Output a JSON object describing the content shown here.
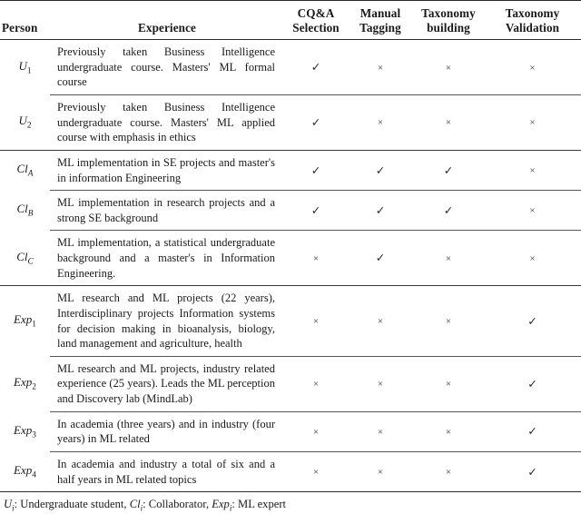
{
  "table": {
    "headers": {
      "person": "Person",
      "experience": "Experience",
      "cqa_selection": [
        "CQ&A",
        "Selection"
      ],
      "manual_tagging": [
        "Manual",
        "Tagging"
      ],
      "taxonomy_building": [
        "Taxonomy",
        "building"
      ],
      "taxonomy_validation": [
        "Taxonomy",
        "Validation"
      ]
    },
    "marks": {
      "check": "✓",
      "cross": "×"
    },
    "groups": [
      {
        "name": "undergraduate-students",
        "rows": [
          {
            "person_base": "U",
            "person_sub": "1",
            "experience": "Previously taken Business Intelligence undergraduate course. Masters' ML formal course",
            "cqa_selection": "check",
            "manual_tagging": "cross",
            "taxonomy_building": "cross",
            "taxonomy_validation": "cross"
          },
          {
            "person_base": "U",
            "person_sub": "2",
            "experience": "Previously taken Business Intelligence undergraduate course. Masters' ML applied course with emphasis in ethics",
            "cqa_selection": "check",
            "manual_tagging": "cross",
            "taxonomy_building": "cross",
            "taxonomy_validation": "cross"
          }
        ]
      },
      {
        "name": "collaborators",
        "rows": [
          {
            "person_base": "Cl",
            "person_sub": "A",
            "experience": "ML implementation in SE projects and master's in information Engineering",
            "cqa_selection": "check",
            "manual_tagging": "check",
            "taxonomy_building": "check",
            "taxonomy_validation": "cross"
          },
          {
            "person_base": "Cl",
            "person_sub": "B",
            "experience": "ML implementation in research projects and a strong SE background",
            "cqa_selection": "check",
            "manual_tagging": "check",
            "taxonomy_building": "check",
            "taxonomy_validation": "cross"
          },
          {
            "person_base": "Cl",
            "person_sub": "C",
            "experience": "ML implementation, a statistical undergraduate background and a master's in Information Engineering.",
            "cqa_selection": "cross",
            "manual_tagging": "check",
            "taxonomy_building": "cross",
            "taxonomy_validation": "cross"
          }
        ]
      },
      {
        "name": "ml-experts",
        "rows": [
          {
            "person_base": "Exp",
            "person_sub": "1",
            "experience": "ML research and ML projects (22 years), Interdisciplinary projects Information systems for decision making in bioanalysis, biology, land management and agriculture, health",
            "cqa_selection": "cross",
            "manual_tagging": "cross",
            "taxonomy_building": "cross",
            "taxonomy_validation": "check"
          },
          {
            "person_base": "Exp",
            "person_sub": "2",
            "experience": "ML research and ML projects, industry related experience (25 years). Leads the ML perception and Discovery lab (MindLab)",
            "cqa_selection": "cross",
            "manual_tagging": "cross",
            "taxonomy_building": "cross",
            "taxonomy_validation": "check"
          },
          {
            "person_base": "Exp",
            "person_sub": "3",
            "experience": "In academia (three years) and in industry (four years) in ML related",
            "cqa_selection": "cross",
            "manual_tagging": "cross",
            "taxonomy_building": "cross",
            "taxonomy_validation": "check"
          },
          {
            "person_base": "Exp",
            "person_sub": "4",
            "experience": "In academia and industry a total of six and a half years in ML related topics",
            "cqa_selection": "cross",
            "manual_tagging": "cross",
            "taxonomy_building": "cross",
            "taxonomy_validation": "check"
          }
        ]
      }
    ],
    "footnote": {
      "parts": [
        {
          "symbol": "U",
          "sub": "i",
          "text": ": Undergraduate student, "
        },
        {
          "symbol": "Cl",
          "sub": "i",
          "text": ": Collaborator, "
        },
        {
          "symbol": "Exp",
          "sub": "i",
          "text": ": ML expert"
        }
      ]
    }
  }
}
